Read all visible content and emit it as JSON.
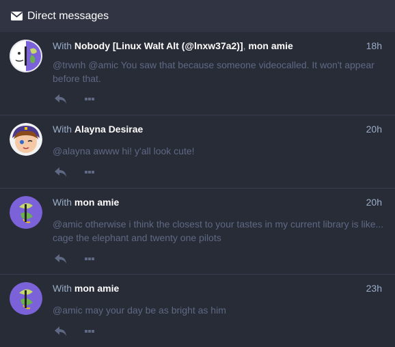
{
  "header": {
    "title": "Direct messages",
    "icon": "envelope-icon"
  },
  "with_label": "With",
  "conversations": [
    {
      "participants": [
        "Nobody [Linux Walt Alt (@lnxw37a2)]",
        "mon amie"
      ],
      "separator": ",",
      "time": "18h",
      "message": "@trwnh @amic You saw that because someone videocalled. It won't appear before that."
    },
    {
      "participants": [
        "Alayna Desirae"
      ],
      "time": "20h",
      "message": "@alayna awww hi! y'all look cute!"
    },
    {
      "participants": [
        "mon amie"
      ],
      "time": "20h",
      "message": "@amic otherwise i think the closest to your tastes in my current library is like... cage the elephant and twenty one pilots"
    },
    {
      "participants": [
        "mon amie"
      ],
      "time": "23h",
      "message": "@amic may your day be as bright as him"
    }
  ],
  "colors": {
    "background": "#282c37",
    "header": "#313543",
    "meta_text": "#9baec8",
    "message_text": "#606984",
    "icon": "#606984"
  }
}
